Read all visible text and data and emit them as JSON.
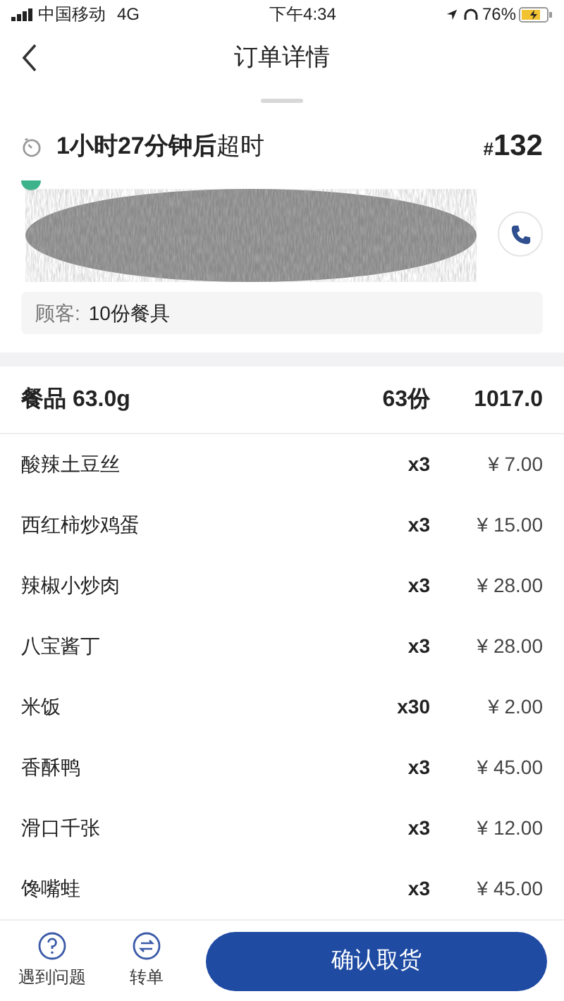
{
  "status_bar": {
    "carrier": "中国移动",
    "network": "4G",
    "time": "下午4:34",
    "battery": "76%"
  },
  "header": {
    "title": "订单详情"
  },
  "order": {
    "timer_prefix": "1小时27分钟后",
    "timer_suffix": "超时",
    "number_mark": "#",
    "number": "132"
  },
  "customer_note": {
    "label": "顾客:",
    "value": "10份餐具"
  },
  "items_header": {
    "label": "餐品 63.0g",
    "count": "63份",
    "total": "1017.0"
  },
  "items": [
    {
      "name": "酸辣土豆丝",
      "qty": "x3",
      "price": "¥ 7.00"
    },
    {
      "name": "西红柿炒鸡蛋",
      "qty": "x3",
      "price": "¥ 15.00"
    },
    {
      "name": "辣椒小炒肉",
      "qty": "x3",
      "price": "¥ 28.00"
    },
    {
      "name": "八宝酱丁",
      "qty": "x3",
      "price": "¥ 28.00"
    },
    {
      "name": "米饭",
      "qty": "x30",
      "price": "¥ 2.00"
    },
    {
      "name": "香酥鸭",
      "qty": "x3",
      "price": "¥ 45.00"
    },
    {
      "name": "滑口千张",
      "qty": "x3",
      "price": "¥ 12.00"
    },
    {
      "name": "馋嘴蛙",
      "qty": "x3",
      "price": "¥ 45.00"
    }
  ],
  "bottom_bar": {
    "help": "遇到问题",
    "transfer": "转单",
    "confirm": "确认取货"
  }
}
